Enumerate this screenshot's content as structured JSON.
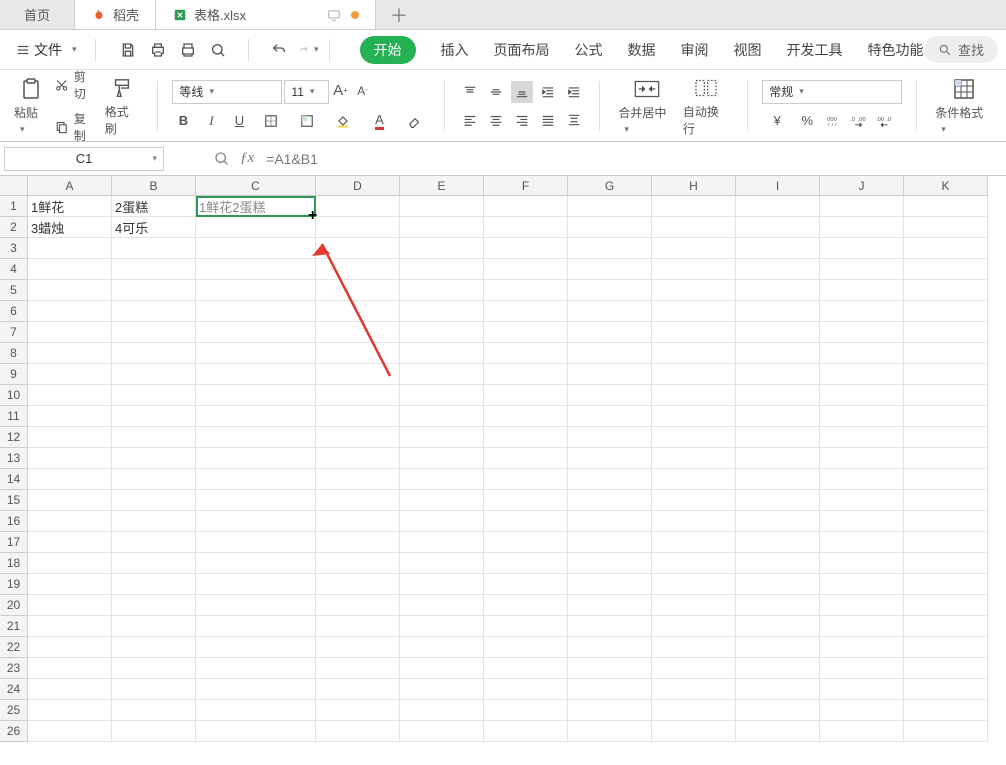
{
  "tabs": {
    "home": "首页",
    "shell": "稻壳",
    "file": "表格.xlsx"
  },
  "file_menu": "文件",
  "ribbon": {
    "start": "开始",
    "insert": "插入",
    "layout": "页面布局",
    "formula": "公式",
    "data": "数据",
    "review": "审阅",
    "view": "视图",
    "dev": "开发工具",
    "special": "特色功能"
  },
  "search_label": "查找",
  "toolbar": {
    "paste": "粘贴",
    "cut": "剪切",
    "copy": "复制",
    "format_painter": "格式刷",
    "font_name": "等线",
    "font_size": "11",
    "merge": "合并居中",
    "wrap": "自动换行",
    "number_format": "常规",
    "cond_fmt": "条件格式"
  },
  "namebox": "C1",
  "formula": "=A1&B1",
  "columns": [
    "A",
    "B",
    "C",
    "D",
    "E",
    "F",
    "G",
    "H",
    "I",
    "J",
    "K"
  ],
  "rows": 26,
  "chart_data": {
    "type": "table",
    "cells": {
      "A1": "1鲜花",
      "B1": "2蛋糕",
      "C1": "1鲜花2蛋糕",
      "A2": "3蜡烛",
      "B2": "4可乐"
    },
    "selected": "C1"
  }
}
